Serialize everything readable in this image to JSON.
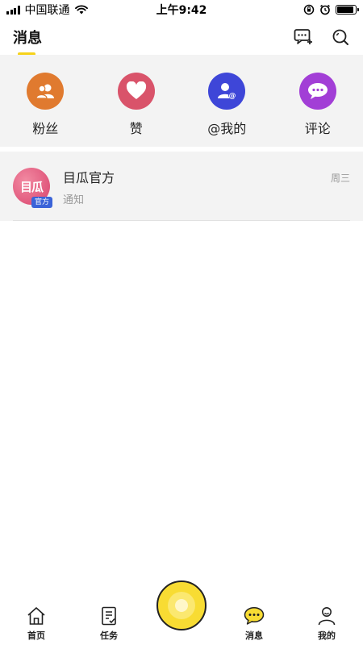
{
  "status_bar": {
    "carrier": "中国联通",
    "time": "上午9:42",
    "battery_level": 0.9
  },
  "header": {
    "title": "消息",
    "actions": [
      {
        "name": "chat-add-icon"
      },
      {
        "name": "search-icon"
      }
    ]
  },
  "quick_actions": [
    {
      "label": "粉丝",
      "icon": "fans-icon",
      "color": "#e07a2f"
    },
    {
      "label": "赞",
      "icon": "heart-icon",
      "color": "#d9536a"
    },
    {
      "label": "@我的",
      "icon": "mention-icon",
      "color": "#3e46d8"
    },
    {
      "label": "评论",
      "icon": "comment-icon",
      "color": "#a23ed6"
    }
  ],
  "messages": [
    {
      "avatar_text": "目瓜",
      "badge": "官方",
      "name": "目瓜官方",
      "preview": "通知",
      "time": "周三"
    }
  ],
  "tab_bar": {
    "items": [
      {
        "label": "首页",
        "icon": "home-icon"
      },
      {
        "label": "任务",
        "icon": "task-icon"
      },
      {
        "label": "",
        "icon": "center-action-icon"
      },
      {
        "label": "消息",
        "icon": "message-icon",
        "active": true
      },
      {
        "label": "我的",
        "icon": "profile-icon"
      }
    ],
    "accent_color": "#f8dc33"
  }
}
